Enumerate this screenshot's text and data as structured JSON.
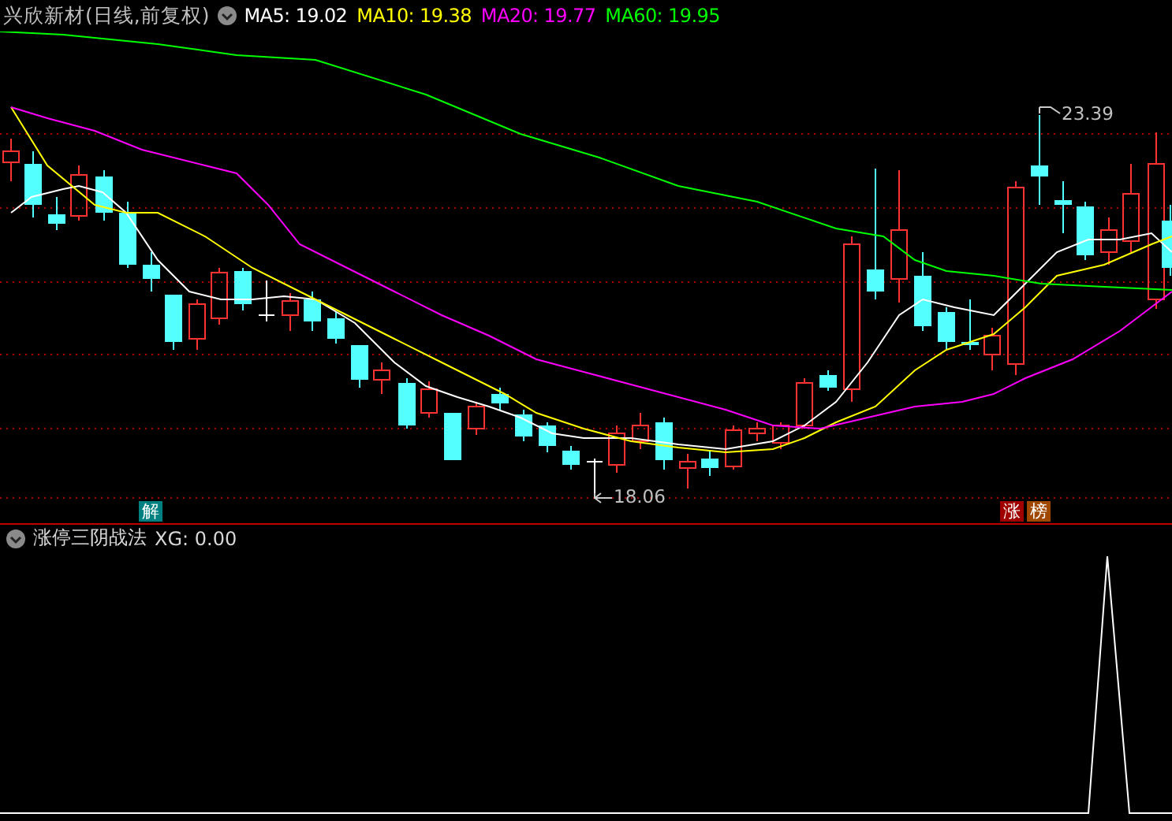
{
  "header": {
    "title": "兴欣新材(日线,前复权)",
    "indicators": [
      {
        "label": "MA5: 19.02",
        "color": "#ffffff"
      },
      {
        "label": "MA10: 19.38",
        "color": "#ffff00"
      },
      {
        "label": "MA20: 19.77",
        "color": "#ff00ff"
      },
      {
        "label": "MA60: 19.95",
        "color": "#00ff00"
      }
    ]
  },
  "chart": {
    "high_label": "23.39",
    "low_label": "18.06",
    "markers": [
      {
        "text": "解",
        "color": "#008080"
      },
      {
        "text": "涨",
        "color": "#a00000"
      },
      {
        "text": "榜",
        "color": "#a04800"
      }
    ]
  },
  "sub_panel": {
    "title": "涨停三阴战法",
    "readout": "XG: 0.00"
  }
}
